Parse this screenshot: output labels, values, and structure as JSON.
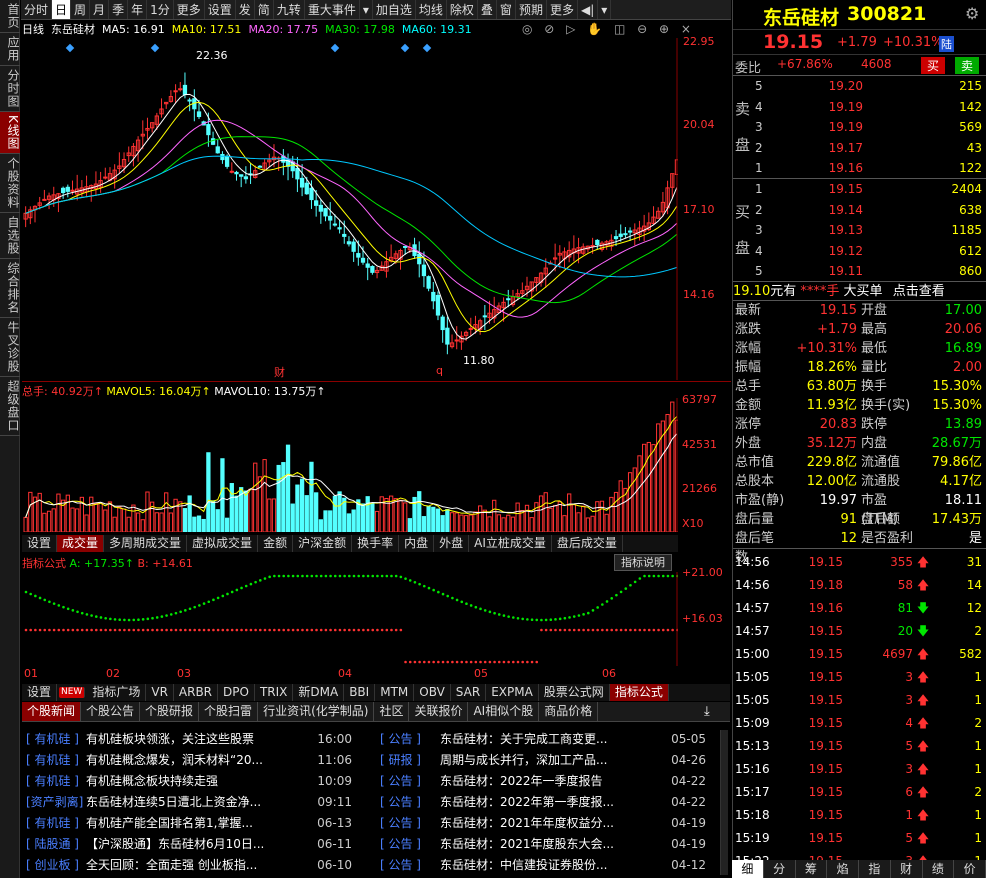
{
  "left_tabs": [
    "首页",
    "应用",
    "分时图",
    "K线图",
    "个股资料",
    "自选股",
    "综合排名",
    "牛叉诊股",
    "超级盘口"
  ],
  "toolbar": [
    "分时",
    "日",
    "周",
    "月",
    "季",
    "年",
    "1分",
    "更多",
    "设置",
    "发",
    "简",
    "九转",
    "重大事件",
    "▾",
    "加自选",
    "均线",
    "除权",
    "叠",
    "窗",
    "预期",
    "更多",
    "◀|",
    "▾"
  ],
  "kline_legend": {
    "period": "日线",
    "name": "东岳硅材",
    "ma5": "MA5: 16.91",
    "ma10": "MA10: 17.51",
    "ma20": "MA20: 17.75",
    "ma30": "MA30: 17.98",
    "ma60": "MA60: 19.31"
  },
  "price_axis": [
    "22.95",
    "20.04",
    "17.10",
    "14.16"
  ],
  "annotations": {
    "high": "22.36",
    "low": "11.80",
    "cai": "财",
    "q": "q"
  },
  "vol_legend": {
    "total": "总手: 40.92万↑",
    "mavol5": "MAVOL5: 16.04万↑",
    "mavol10": "MAVOL10: 13.75万↑"
  },
  "vol_axis": [
    "63797",
    "42531",
    "21266",
    "X10"
  ],
  "vol_tabs": [
    "设置",
    "成交量",
    "多周期成交量",
    "虚拟成交量",
    "金额",
    "沪深金额",
    "换手率",
    "内盘",
    "外盘",
    "AI立桩成交量",
    "盘后成交量"
  ],
  "idx_legend": {
    "name": "指标公式",
    "a": "A: +17.35↑",
    "b": "B: +14.61",
    "help": "指标说明"
  },
  "idx_axis": [
    "+21.00",
    "+16.03"
  ],
  "months": [
    "01",
    "02",
    "03",
    "04",
    "05",
    "06"
  ],
  "idx_tabs": [
    "设置",
    "NEW",
    "指标广场",
    "VR",
    "ARBR",
    "DPO",
    "TRIX",
    "新DMA",
    "BBI",
    "MTM",
    "OBV",
    "SAR",
    "EXPMA",
    "股票公式网",
    "指标公式"
  ],
  "news_tabs": [
    "个股新闻",
    "个股公告",
    "个股研报",
    "个股扫雷",
    "行业资讯(化学制品)",
    "社区",
    "关联报价",
    "AI相似个股",
    "商品价格"
  ],
  "news_left": [
    {
      "tag": "[ 有机硅 ]",
      "title": "有机硅板块领涨，关注这些股票",
      "date": "16:00"
    },
    {
      "tag": "[ 有机硅 ]",
      "title": "有机硅概念爆发，润禾材料“20...",
      "date": "11:06"
    },
    {
      "tag": "[ 有机硅 ]",
      "title": "有机硅概念板块持续走强",
      "date": "10:09"
    },
    {
      "tag": "[资产剥离]",
      "title": "东岳硅材连续5日遭北上资金净...",
      "date": "09:11"
    },
    {
      "tag": "[ 有机硅 ]",
      "title": "有机硅产能全国排名第1,掌握...",
      "date": "06-13"
    },
    {
      "tag": "[ 陆股通 ]",
      "title": "【沪深股通】东岳硅材6月10日...",
      "date": "06-11"
    },
    {
      "tag": "[ 创业板 ]",
      "title": "全天回顾：全面走强 创业板指...",
      "date": "06-10"
    }
  ],
  "news_right": [
    {
      "tag": "[ 公告 ]",
      "title": "东岳硅材：关于完成工商变更...",
      "date": "05-05"
    },
    {
      "tag": "[ 研报 ]",
      "title": "周期与成长并行，深加工产品...",
      "date": "04-26"
    },
    {
      "tag": "[ 公告 ]",
      "title": "东岳硅材：2022年一季度报告",
      "date": "04-22"
    },
    {
      "tag": "[ 公告 ]",
      "title": "东岳硅材：2022年第一季度报...",
      "date": "04-22"
    },
    {
      "tag": "[ 公告 ]",
      "title": "东岳硅材：2021年年度权益分...",
      "date": "04-19"
    },
    {
      "tag": "[ 公告 ]",
      "title": "东岳硅材：2021年度股东大会...",
      "date": "04-19"
    },
    {
      "tag": "[ 公告 ]",
      "title": "东岳硅材：中信建投证券股份...",
      "date": "04-12"
    }
  ],
  "stock": {
    "name": "东岳硅材",
    "code": "300821",
    "price": "19.15",
    "change": "+1.79",
    "pct": "+10.31%",
    "tag": "陆"
  },
  "weibi": {
    "label": "委比",
    "value": "+67.86%",
    "diff": "4608",
    "buy": "买",
    "sell": "卖"
  },
  "sell_levels": [
    {
      "lv": "5",
      "p": "19.20",
      "v": "215"
    },
    {
      "lv": "4",
      "p": "19.19",
      "v": "142"
    },
    {
      "lv": "3",
      "p": "19.19",
      "v": "569"
    },
    {
      "lv": "2",
      "p": "19.17",
      "v": "43"
    },
    {
      "lv": "1",
      "p": "19.16",
      "v": "122"
    }
  ],
  "buy_levels": [
    {
      "lv": "1",
      "p": "19.15",
      "v": "2404"
    },
    {
      "lv": "2",
      "p": "19.14",
      "v": "638"
    },
    {
      "lv": "3",
      "p": "19.13",
      "v": "1185"
    },
    {
      "lv": "4",
      "p": "19.12",
      "v": "612"
    },
    {
      "lv": "5",
      "p": "19.11",
      "v": "860"
    }
  ],
  "sell_label": [
    "卖",
    "盘"
  ],
  "buy_label": [
    "买",
    "盘"
  ],
  "big_order": {
    "price": "19.10",
    "unit": "元有",
    "hand": "****手",
    "label": "大买单",
    "link": "点击查看"
  },
  "stats": [
    {
      "k": "最新",
      "v": "19.15",
      "vc": "red",
      "k2": "开盘",
      "v2": "17.00",
      "v2c": "grn"
    },
    {
      "k": "涨跌",
      "v": "+1.79",
      "vc": "red",
      "k2": "最高",
      "v2": "20.06",
      "v2c": "red"
    },
    {
      "k": "涨幅",
      "v": "+10.31%",
      "vc": "red",
      "k2": "最低",
      "v2": "16.89",
      "v2c": "grn"
    },
    {
      "k": "振幅",
      "v": "18.26%",
      "vc": "yel",
      "k2": "量比",
      "v2": "2.00",
      "v2c": "red"
    },
    {
      "k": "总手",
      "v": "63.80万",
      "vc": "yel",
      "k2": "换手",
      "v2": "15.30%",
      "v2c": "yel"
    },
    {
      "k": "金额",
      "v": "11.93亿",
      "vc": "yel",
      "k2": "换手(实)",
      "v2": "15.30%",
      "v2c": "yel"
    },
    {
      "k": "涨停",
      "v": "20.83",
      "vc": "red",
      "k2": "跌停",
      "v2": "13.89",
      "v2c": "grn"
    },
    {
      "k": "外盘",
      "v": "35.12万",
      "vc": "red",
      "k2": "内盘",
      "v2": "28.67万",
      "v2c": "grn"
    },
    {
      "k": "总市值",
      "v": "229.8亿",
      "vc": "yel",
      "k2": "流通值",
      "v2": "79.86亿",
      "v2c": "yel"
    },
    {
      "k": "总股本",
      "v": "12.00亿",
      "vc": "yel",
      "k2": "流通股",
      "v2": "4.17亿",
      "v2c": "yel"
    },
    {
      "k": "市盈(静)",
      "v": "19.97",
      "vc": "wht",
      "k2": "市盈(TTM)",
      "v2": "18.11",
      "v2c": "wht"
    },
    {
      "k": "盘后量",
      "v": "91",
      "vc": "yel",
      "k2": "盘后额",
      "v2": "17.43万",
      "v2c": "yel"
    },
    {
      "k": "盘后笔数",
      "v": "12",
      "vc": "yel",
      "k2": "是否盈利",
      "v2": "是",
      "v2c": "wht"
    }
  ],
  "ticks": [
    {
      "t": "14:56",
      "p": "19.15",
      "v": "355",
      "d": "up",
      "n": "31"
    },
    {
      "t": "14:56",
      "p": "19.18",
      "v": "58",
      "d": "up",
      "n": "14"
    },
    {
      "t": "14:57",
      "p": "19.16",
      "v": "81",
      "d": "down",
      "n": "12"
    },
    {
      "t": "14:57",
      "p": "19.15",
      "v": "20",
      "d": "down",
      "n": "2"
    },
    {
      "t": "15:00",
      "p": "19.15",
      "v": "4697",
      "d": "up",
      "n": "582"
    },
    {
      "t": "15:05",
      "p": "19.15",
      "v": "3",
      "d": "up",
      "n": "1"
    },
    {
      "t": "15:05",
      "p": "19.15",
      "v": "3",
      "d": "up",
      "n": "1"
    },
    {
      "t": "15:09",
      "p": "19.15",
      "v": "4",
      "d": "up",
      "n": "2"
    },
    {
      "t": "15:13",
      "p": "19.15",
      "v": "5",
      "d": "up",
      "n": "1"
    },
    {
      "t": "15:16",
      "p": "19.15",
      "v": "3",
      "d": "up",
      "n": "1"
    },
    {
      "t": "15:17",
      "p": "19.15",
      "v": "6",
      "d": "up",
      "n": "2"
    },
    {
      "t": "15:18",
      "p": "19.15",
      "v": "1",
      "d": "up",
      "n": "1"
    },
    {
      "t": "15:19",
      "p": "19.15",
      "v": "5",
      "d": "up",
      "n": "1"
    },
    {
      "t": "15:22",
      "p": "19.15",
      "v": "3",
      "d": "up",
      "n": "1"
    }
  ],
  "bottom_tabs": [
    "细",
    "分",
    "筹",
    "焰",
    "指",
    "财",
    "绩",
    "价"
  ],
  "colors": {
    "up": "#ff3232",
    "down": "#54ffff",
    "ma5": "#ffffff",
    "ma10": "#ffff00",
    "ma20": "#ff66ff",
    "ma30": "#00e600",
    "ma60": "#00c8ff"
  }
}
